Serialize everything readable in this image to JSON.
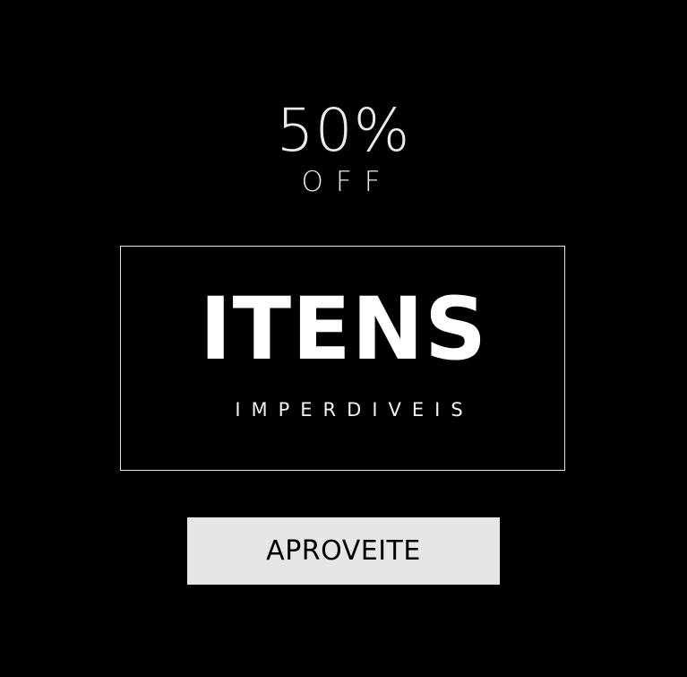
{
  "discount": {
    "percent": "50%",
    "off": "OFF"
  },
  "promo": {
    "title": "ITENS",
    "subtitle": "IMPERDIVEIS"
  },
  "cta": {
    "label": "APROVEITE"
  },
  "colors": {
    "background": "#000000",
    "text": "#ffffff",
    "button_background": "#e6e6e6",
    "button_text": "#000000"
  }
}
